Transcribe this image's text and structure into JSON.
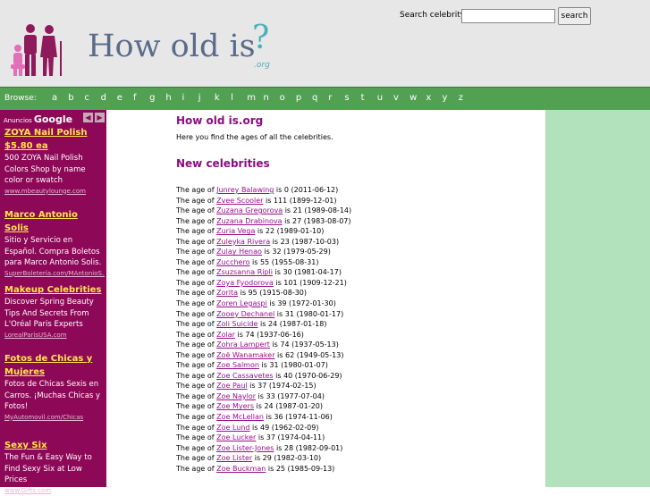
{
  "header": {
    "logo_text": "How old is",
    "logo_q": "?",
    "logo_org": ".org",
    "search_label": "Search celebrity:",
    "search_value": "",
    "search_button": "search"
  },
  "nav": {
    "label": "Browse:",
    "letters": [
      "a",
      "b",
      "c",
      "d",
      "e",
      "f",
      "g",
      "h",
      "i",
      "j",
      "k",
      "l",
      "m",
      "n",
      "o",
      "p",
      "q",
      "r",
      "s",
      "t",
      "u",
      "v",
      "w",
      "x",
      "y",
      "z"
    ]
  },
  "ads": {
    "label": "Anuncios",
    "brand": "Google",
    "items": [
      {
        "title": "ZOYA Nail Polish $5.80 ea",
        "desc": "500 ZOYA Nail Polish Colors Shop by name color or swatch",
        "url": "www.mbeautylounge.com"
      },
      {
        "title": "Marco Antonio Solis",
        "desc": "Sitio y Servicio en Español. Compra Boletos para Marco Antonio Solis.",
        "url": "SuperBoletería.com/MAntonioS..."
      },
      {
        "title": "Makeup Celebrities",
        "desc": "Discover Spring Beauty Tips And Secrets From L'Oréal Paris Experts",
        "url": "LorealParisUSA.com"
      },
      {
        "title": "Fotos de Chicas y Mujeres",
        "desc": "Fotos de Chicas Sexis en Carros. ¡Muchas Chicas y Fotos!",
        "url": "MyAutomovil.com/Chicas"
      },
      {
        "title": "Sexy Six",
        "desc": "The Fun & Easy Way to Find Sexy Six at Low Prices",
        "url": "www.Gifts.com"
      }
    ]
  },
  "main": {
    "title": "How old is.org",
    "intro": "Here you find the ages of all the celebrities.",
    "section_title": "New celebrities",
    "prefix": "The age of",
    "celebrities": [
      {
        "name": "Junrey Balawing",
        "age": "0",
        "birth": "2011-06-12"
      },
      {
        "name": "Zvee Scooler",
        "age": "111",
        "birth": "1899-12-01"
      },
      {
        "name": "Zuzana Gregorova",
        "age": "21",
        "birth": "1989-08-14"
      },
      {
        "name": "Zuzana Drabinova",
        "age": "27",
        "birth": "1983-08-07"
      },
      {
        "name": "Zuria Vega",
        "age": "22",
        "birth": "1989-01-10"
      },
      {
        "name": "Zuleyka Rivera",
        "age": "23",
        "birth": "1987-10-03"
      },
      {
        "name": "Zulay Henao",
        "age": "32",
        "birth": "1979-05-29"
      },
      {
        "name": "Zucchero",
        "age": "55",
        "birth": "1955-08-31"
      },
      {
        "name": "Zsuzsanna Ripli",
        "age": "30",
        "birth": "1981-04-17"
      },
      {
        "name": "Zoya Fyodorova",
        "age": "101",
        "birth": "1909-12-21"
      },
      {
        "name": "Zorita",
        "age": "95",
        "birth": "1915-08-30"
      },
      {
        "name": "Zoren Legaspi",
        "age": "39",
        "birth": "1972-01-30"
      },
      {
        "name": "Zooey Dechanel",
        "age": "31",
        "birth": "1980-01-17"
      },
      {
        "name": "Zoli Suicide",
        "age": "24",
        "birth": "1987-01-18"
      },
      {
        "name": "Zolar",
        "age": "74",
        "birth": "1937-06-16"
      },
      {
        "name": "Zohra Lampert",
        "age": "74",
        "birth": "1937-05-13"
      },
      {
        "name": "Zoë Wanamaker",
        "age": "62",
        "birth": "1949-05-13"
      },
      {
        "name": "Zoe Salmon",
        "age": "31",
        "birth": "1980-01-07"
      },
      {
        "name": "Zoe Cassavetes",
        "age": "40",
        "birth": "1970-06-29"
      },
      {
        "name": "Zoe Paul",
        "age": "37",
        "birth": "1974-02-15"
      },
      {
        "name": "Zoe Naylor",
        "age": "33",
        "birth": "1977-07-04"
      },
      {
        "name": "Zoe Myers",
        "age": "24",
        "birth": "1987-01-20"
      },
      {
        "name": "Zoe McLellan",
        "age": "36",
        "birth": "1974-11-06"
      },
      {
        "name": "Zoe Lund",
        "age": "49",
        "birth": "1962-02-09"
      },
      {
        "name": "Zoe Lucker",
        "age": "37",
        "birth": "1974-04-11"
      },
      {
        "name": "Zoe Lister-Jones",
        "age": "28",
        "birth": "1982-09-01"
      },
      {
        "name": "Zoe Lister",
        "age": "29",
        "birth": "1982-03-10"
      },
      {
        "name": "Zoe Buckman",
        "age": "25",
        "birth": "1985-09-13"
      }
    ]
  },
  "colors": {
    "header_bg": "#e7e7e7",
    "nav_bg": "#52a153",
    "sidebar_bg": "#8e0858",
    "title_color": "#8b0d82",
    "right_bg": "#b2e2bb"
  }
}
